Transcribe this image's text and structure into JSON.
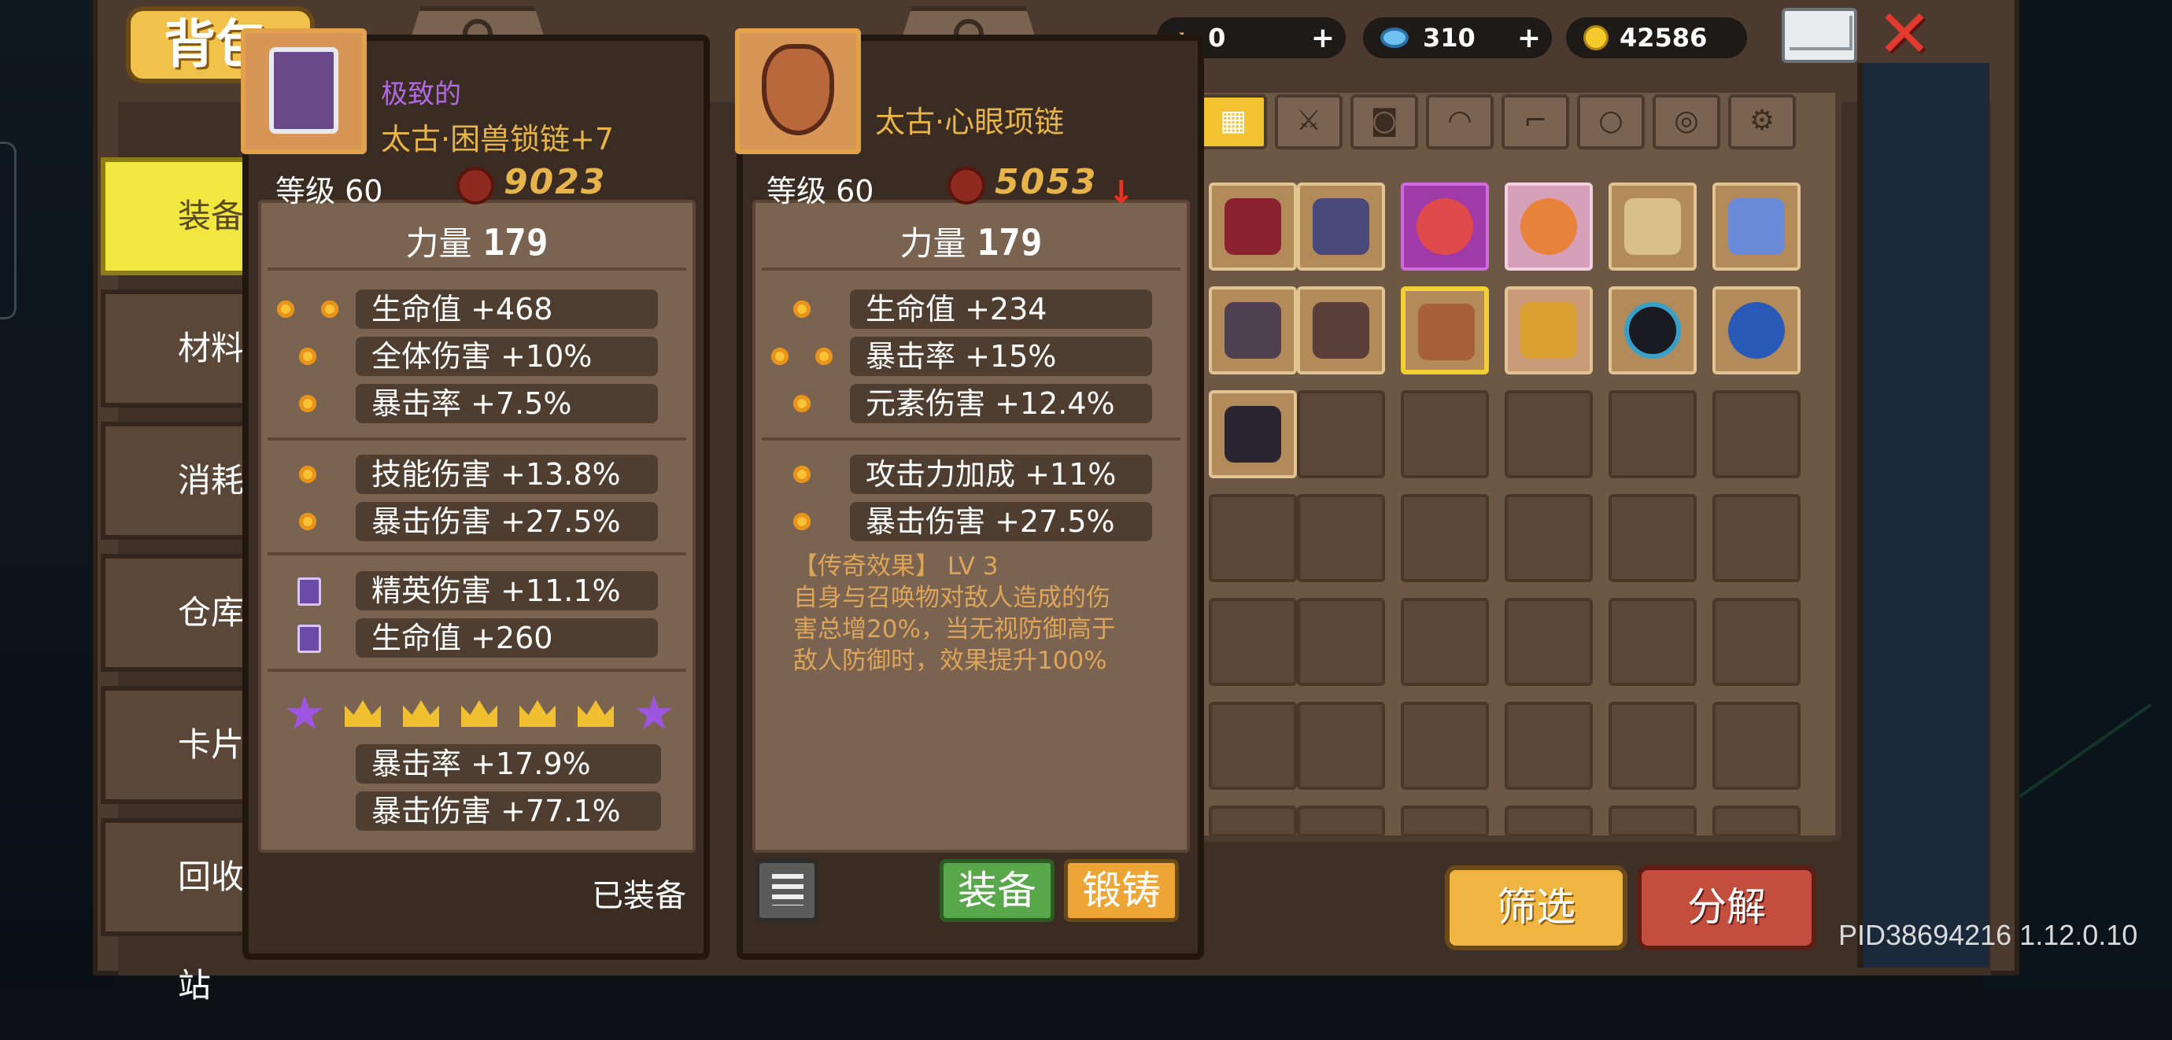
{
  "title": "背包",
  "categories": [
    {
      "label": "装备",
      "active": true
    },
    {
      "label": "材料",
      "active": false
    },
    {
      "label": "消耗品",
      "active": false
    },
    {
      "label": "仓库",
      "active": false
    },
    {
      "label": "卡片",
      "active": false
    },
    {
      "label": "回收站",
      "active": false
    }
  ],
  "currencies": {
    "arrows": "0",
    "gems": "310",
    "gold": "42586"
  },
  "item_left": {
    "quality": "极致的",
    "name": "太古·困兽锁链+7",
    "level": "等级 60",
    "power": "9023",
    "strength_label": "力量",
    "strength_value": "179",
    "stats": [
      "生命值 +468",
      "全体伤害 +10%",
      "暴击率 +7.5%",
      "技能伤害 +13.8%",
      "暴击伤害 +27.5%",
      "精英伤害 +11.1%",
      "生命值 +260"
    ],
    "bonus_stats": [
      "暴击率 +17.9%",
      "暴击伤害 +77.1%"
    ],
    "equipped_label": "已装备"
  },
  "item_right": {
    "name": "太古·心眼项链",
    "level": "等级 60",
    "power": "5053",
    "strength_label": "力量",
    "strength_value": "179",
    "stats": [
      "生命值 +234",
      "暴击率 +15%",
      "元素伤害 +12.4%",
      "攻击力加成 +11%",
      "暴击伤害 +27.5%"
    ],
    "legend_title": "【传奇效果】 LV 3",
    "legend_text_1": "自身与召唤物对敌人造成的伤",
    "legend_text_2": "害总增20%，当无视防御高于",
    "legend_text_3": "敌人防御时，效果提升100%",
    "equip_label": "装备",
    "forge_label": "锻铸"
  },
  "buttons": {
    "filter": "筛选",
    "decompose": "分解"
  },
  "pid": "PID38694216 1.12.0.10",
  "colors": {
    "accent_yellow": "#f2e640",
    "gold": "#e6b44a",
    "red": "#c44e3e",
    "green": "#58a74a",
    "legend": "#dda55a",
    "quality_purple": "#b06ae0"
  }
}
